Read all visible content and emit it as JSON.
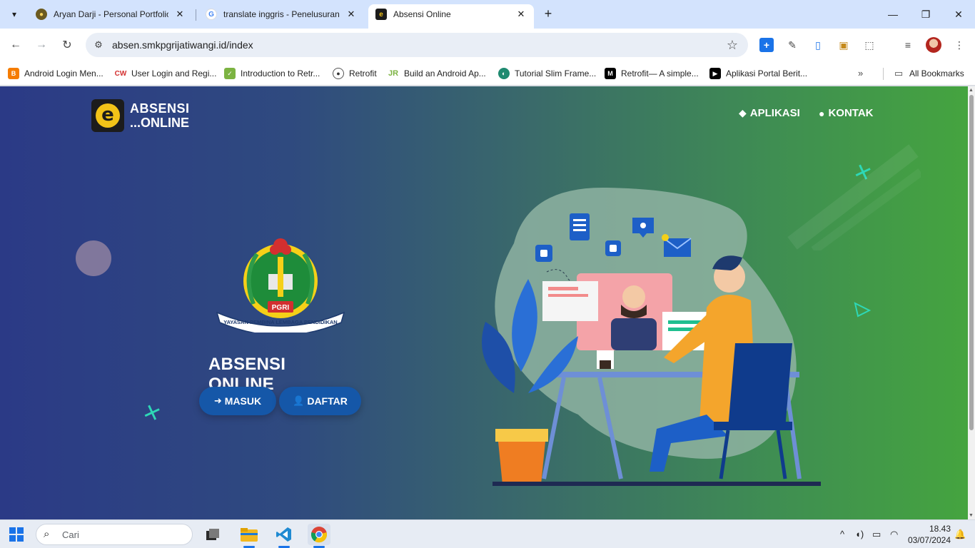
{
  "browser": {
    "tabs": [
      {
        "title": "Aryan Darji - Personal Portfolio",
        "icon": "portfolio-favicon"
      },
      {
        "title": "translate inggris - Penelusuran G",
        "icon": "google-favicon"
      },
      {
        "title": "Absensi Online",
        "icon": "absensi-favicon",
        "active": true
      }
    ],
    "url": "absen.smkpgrijatiwangi.id/index",
    "bookmarks": [
      {
        "label": "Android Login Men...",
        "icon": "blogger-icon"
      },
      {
        "label": "User Login and Regi...",
        "icon": "cw-icon"
      },
      {
        "label": "Introduction to Retr...",
        "icon": "green-doc-icon"
      },
      {
        "label": "Retrofit",
        "icon": "github-icon"
      },
      {
        "label": "Build an Android Ap...",
        "icon": "jr-icon"
      },
      {
        "label": "Tutorial Slim Frame...",
        "icon": "slim-icon"
      },
      {
        "label": "Retrofit— A simple...",
        "icon": "medium-icon"
      },
      {
        "label": "Aplikasi Portal Berit...",
        "icon": "video-icon"
      }
    ],
    "all_bookmarks": "All Bookmarks"
  },
  "page": {
    "logo": {
      "line1": "ABSENSI",
      "line2": "...ONLINE",
      "mark": "e"
    },
    "nav": [
      {
        "label": "APLIKASI",
        "icon": "android-icon"
      },
      {
        "label": "KONTAK",
        "icon": "comments-icon"
      }
    ],
    "emblem": {
      "badge": "PGRI",
      "ribbon": "YAYASAN PEMBINA LEMBAGA PENDIDIKAN"
    },
    "title": "ABSENSI ONLINE",
    "buttons": {
      "masuk": "MASUK",
      "daftar": "DAFTAR"
    },
    "colors": {
      "button": "#1557a8",
      "accent": "#2ed8b6",
      "gradient_start": "#2b3a86",
      "gradient_end": "#45a43f"
    }
  },
  "taskbar": {
    "search_placeholder": "Cari",
    "time": "18.43",
    "date": "03/07/2024"
  }
}
